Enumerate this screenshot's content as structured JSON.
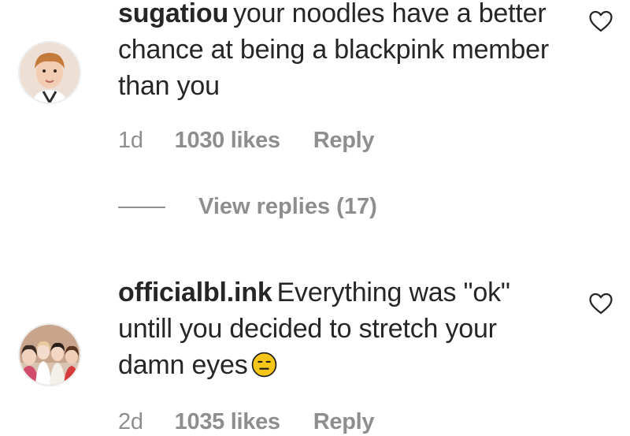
{
  "comments": [
    {
      "username": "sugatiou",
      "text": "your noodles have a better chance at being a blackpink member than you",
      "time": "1d",
      "likes": "1030 likes",
      "reply_label": "Reply",
      "avatar_icon": "avatar-photo-boy",
      "like_icon": "heart-outline-icon"
    },
    {
      "username": "officialbl.ink",
      "text": "Everything was \"ok\" untill you decided to stretch your damn eyes",
      "emoji": "expressionless-face-emoji",
      "time": "2d",
      "likes": "1035 likes",
      "reply_label": "Reply",
      "avatar_icon": "avatar-photo-group",
      "like_icon": "heart-outline-icon"
    }
  ],
  "view_replies_label": "View replies (17)",
  "colors": {
    "text": "#262626",
    "secondary": "#8e8e8e",
    "emoji_yellow": "#f5c518"
  }
}
